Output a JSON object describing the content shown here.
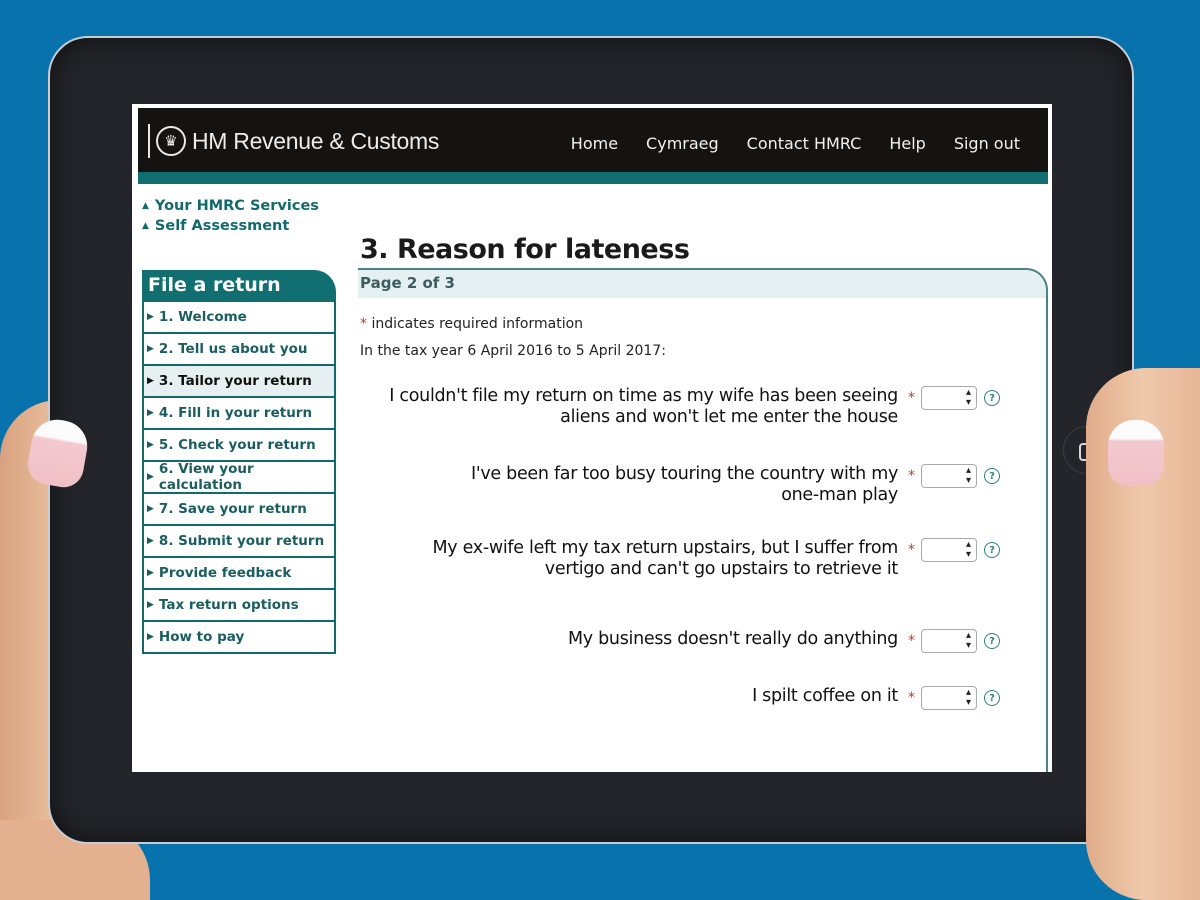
{
  "header": {
    "logo_text": "HM Revenue & Customs",
    "logo_icon": "crown-icon",
    "nav": [
      "Home",
      "Cymraeg",
      "Contact HMRC",
      "Help",
      "Sign out"
    ]
  },
  "breadcrumbs": [
    "Your HMRC Services",
    "Self Assessment"
  ],
  "sidebar": {
    "title": "File a return",
    "items": [
      {
        "label": "1. Welcome",
        "active": false
      },
      {
        "label": "2. Tell us about you",
        "active": false
      },
      {
        "label": "3. Tailor your return",
        "active": true
      },
      {
        "label": "4. Fill in your return",
        "active": false
      },
      {
        "label": "5. Check your return",
        "active": false
      },
      {
        "label": "6. View your calculation",
        "active": false
      },
      {
        "label": "7. Save your return",
        "active": false
      },
      {
        "label": "8. Submit your return",
        "active": false
      },
      {
        "label": "Provide feedback",
        "active": false
      },
      {
        "label": "Tax return options",
        "active": false
      },
      {
        "label": "How to pay",
        "active": false
      }
    ]
  },
  "main": {
    "title": "3. Reason for lateness",
    "page_indicator": "Page 2 of 3",
    "required_star": "*",
    "required_note": " indicates required information",
    "tax_year_text": "In the tax year 6 April 2016 to 5 April 2017:",
    "questions": [
      {
        "label_line1": "I couldn't file my return on time as my wife has been seeing",
        "label_line2": "aliens and won't let me enter the house",
        "value": ""
      },
      {
        "label_line1": "I've been far too busy touring the country with my",
        "label_line2": "one-man play",
        "value": ""
      },
      {
        "label_line1": "My ex-wife left my tax return upstairs, but I suffer from",
        "label_line2": "vertigo and can't go upstairs to retrieve it",
        "value": ""
      },
      {
        "label_line1": "My business doesn't really do anything",
        "label_line2": "",
        "value": ""
      },
      {
        "label_line1": "I spilt coffee on it",
        "label_line2": "",
        "value": ""
      }
    ],
    "help_glyph": "?"
  },
  "colors": {
    "background": "#0872ad",
    "header_bg": "#151311",
    "teal": "#116f72",
    "required": "#d0342c",
    "active_item_bg": "#e6f0f1"
  }
}
